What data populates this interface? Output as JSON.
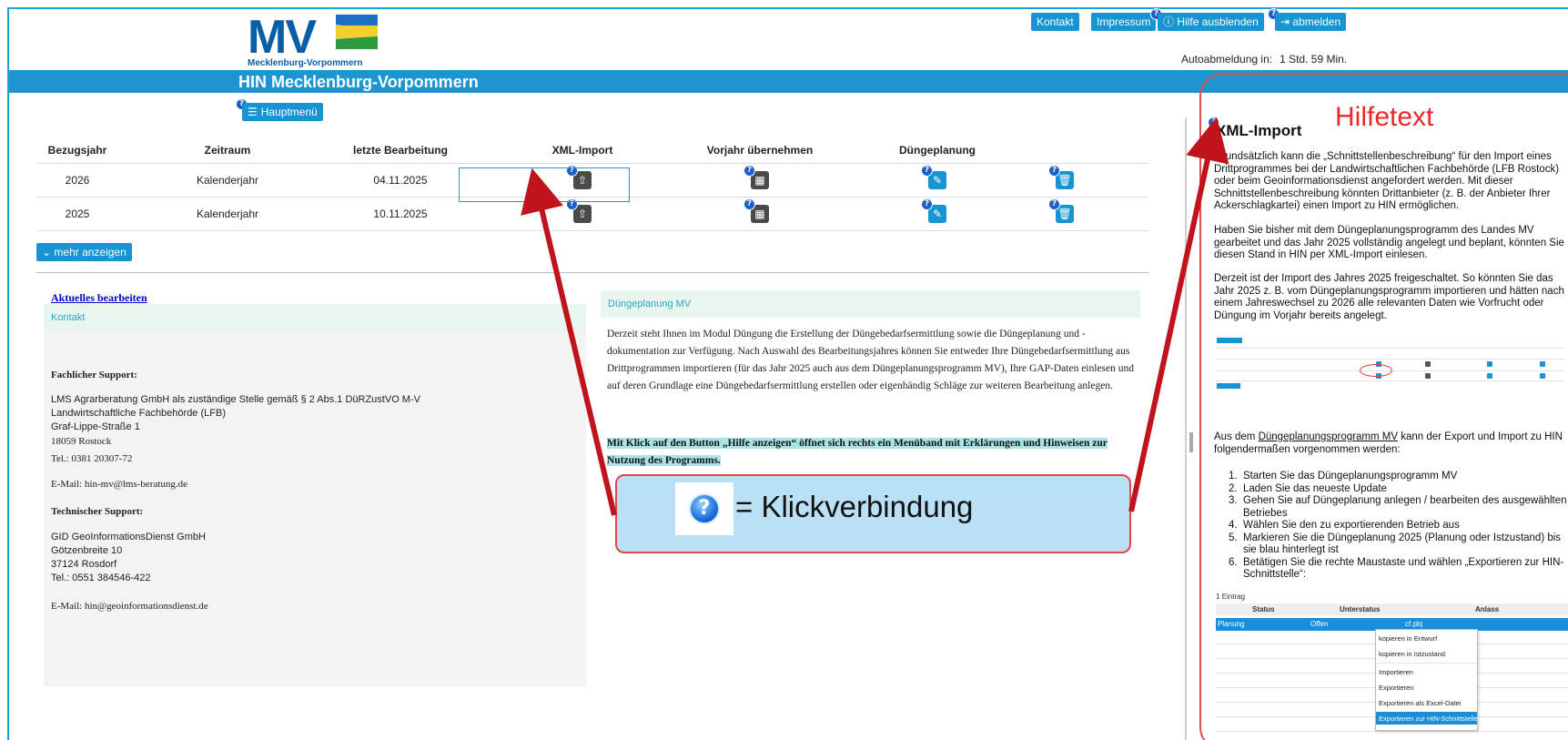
{
  "header": {
    "logo_text": "MV",
    "logo_sub": "Mecklenburg-Vorpommern",
    "title": "HIN Mecklenburg-Vorpommern",
    "buttons": {
      "kontakt": "Kontakt",
      "impressum": "Impressum",
      "hilfe": "Hilfe ausblenden",
      "abmelden": "abmelden"
    },
    "autologout_label": "Autoabmeldung in:",
    "autologout_value": "1 Std. 59 Min.",
    "menu_label": "Hauptmenü"
  },
  "table": {
    "headers": [
      "Bezugsjahr",
      "Zeitraum",
      "letzte Bearbeitung",
      "XML-Import",
      "Vorjahr übernehmen",
      "Düngeplanung"
    ],
    "rows": [
      {
        "jahr": "2026",
        "zeitraum": "Kalenderjahr",
        "bearbeitung": "04.11.2025"
      },
      {
        "jahr": "2025",
        "zeitraum": "Kalenderjahr",
        "bearbeitung": "10.11.2025"
      }
    ],
    "more_label": "mehr anzeigen"
  },
  "left_panel": {
    "edit_link": "Aktuelles bearbeiten",
    "header": "Kontakt",
    "fach_title": "Fachlicher Support:",
    "fach_lines": [
      "LMS Agrarberatung GmbH als zuständige Stelle gemäß § 2 Abs.1 DüRZustVO M-V",
      "Landwirtschaftliche Fachbehörde (LFB)",
      "Graf-Lippe-Straße 1",
      "18059 Rostock",
      "Tel.: 0381 20307-72"
    ],
    "fach_mail": "E-Mail: hin-mv@lms-beratung.de",
    "tech_title": "Technischer Support:",
    "tech_lines": [
      "GID GeoInformationsDienst GmbH",
      "Götzenbreite 10",
      "37124 Rosdorf",
      "Tel.: 0551 384546-422"
    ],
    "tech_mail": "E-Mail: hin@geoinformationsdienst.de"
  },
  "middle_panel": {
    "header": "Düngeplanung MV",
    "text": "Derzeit steht Ihnen im Modul Düngung die Erstellung der Düngebedarfsermittlung sowie die Düngeplanung und -dokumentation zur Verfügung. Nach Auswahl des Bearbeitungsjahres können Sie entweder Ihre Düngebedarfsermittlung aus Drittprogrammen importieren (für das Jahr 2025 auch aus dem Düngeplanungsprogramm MV), Ihre GAP-Daten einlesen und auf deren Grundlage eine Düngebedarfsermittlung erstellen oder eigenhändig Schläge zur weiteren Bearbeitung anlegen.",
    "highlight": "Mit Klick auf den Button „Hilfe anzeigen“ öffnet sich rechts ein Menüband mit Erklärungen und Hinweisen zur Nutzung des Programms."
  },
  "callout": {
    "text": "= Klickverbindung"
  },
  "help": {
    "annotation": "Hilfetext",
    "title": "XML-Import",
    "p1": "Grundsätzlich kann die „Schnittstellenbeschreibung“ für den Import eines Drittprogrammes bei der Landwirtschaftlichen Fachbehörde (LFB Rostock) oder beim Geoinformationsdienst angefordert werden. Mit dieser Schnittstellenbeschreibung könnten Drittanbieter (z. B. der Anbieter Ihrer Ackerschlagkartei) einen Import zu HIN ermöglichen.",
    "p2": "Haben Sie bisher mit dem Düngeplanungsprogramm des Landes MV gearbeitet und das Jahr 2025 vollständig angelegt und beplant, könnten Sie diesen Stand in HIN per XML-Import einlesen.",
    "p3": "Derzeit ist der Import des Jahres 2025 freigeschaltet. So könnten Sie das Jahr 2025 z. B. vom Düngeplanungsprogramm importieren und hätten nach einem Jahreswechsel zu 2026 alle relevanten Daten wie Vorfrucht oder Düngung im Vorjahr bereits angelegt.",
    "p4_pre": "Aus dem ",
    "p4_link": "Düngeplanungsprogramm MV",
    "p4_post": " kann der Export und Import zu HIN folgendermaßen vorgenommen werden:",
    "steps": [
      "Starten Sie das Düngeplanungsprogramm MV",
      "Laden Sie das neueste Update",
      "Gehen Sie auf Düngeplanung anlegen / bearbeiten des ausgewählten Betriebes",
      "Wählen Sie den zu exportierenden Betrieb aus",
      "Markieren Sie die Düngeplanung 2025 (Planung oder Istzustand) bis sie blau hinterlegt ist",
      "Betätigen Sie die rechte Maustaste und wählen „Exportieren zur HIN-Schnittstelle“:"
    ],
    "screenshot": {
      "count": "1 Eintrag",
      "headers": [
        "Status",
        "Unterstatus",
        "Anlass"
      ],
      "sel_row": [
        "Planung",
        "Offen",
        "cf.pbj"
      ],
      "menu": [
        "kopieren in Entwurf",
        "kopieren in Istzustand",
        "Importieren",
        "Exportieren",
        "Exportieren als Excel-Datei",
        "Exportieren zur HIN-Schnittstelle"
      ]
    }
  },
  "colors": {
    "brand_blue": "#1d95d2",
    "annotation_red": "#e0504f"
  }
}
